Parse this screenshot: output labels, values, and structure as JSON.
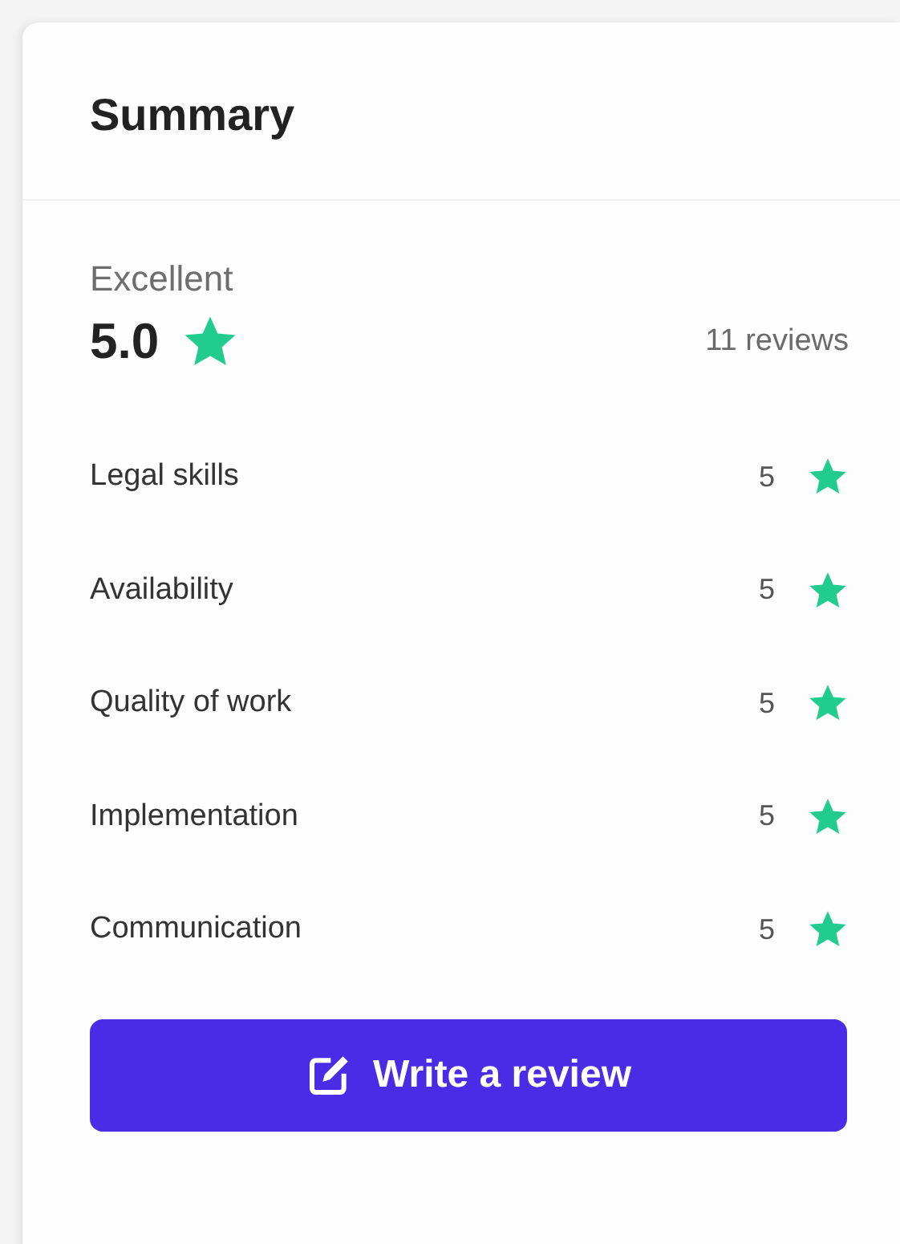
{
  "card": {
    "title": "Summary",
    "overall": {
      "label": "Excellent",
      "score": "5.0",
      "reviews": "11 reviews"
    },
    "criteria": [
      {
        "name": "Legal skills",
        "score": "5"
      },
      {
        "name": "Availability",
        "score": "5"
      },
      {
        "name": "Quality of work",
        "score": "5"
      },
      {
        "name": "Implementation",
        "score": "5"
      },
      {
        "name": "Communication",
        "score": "5"
      }
    ],
    "button": "Write a review"
  }
}
